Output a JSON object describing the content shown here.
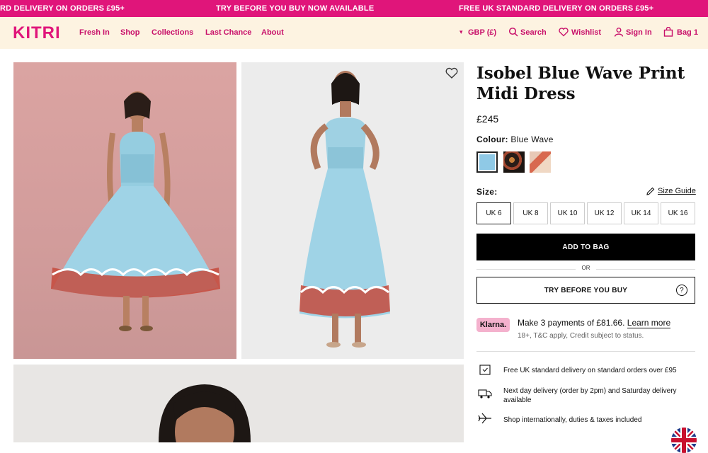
{
  "promo": {
    "left": "RD DELIVERY ON ORDERS £95+",
    "center": "TRY BEFORE YOU BUY NOW AVAILABLE",
    "right": "FREE UK STANDARD DELIVERY ON ORDERS £95+"
  },
  "nav": {
    "logo": "KITRI",
    "links": [
      "Fresh In",
      "Shop",
      "Collections",
      "Last Chance",
      "About"
    ],
    "currency": "GBP (£)",
    "search": "Search",
    "wishlist": "Wishlist",
    "signin": "Sign In",
    "bag": "Bag 1"
  },
  "product": {
    "title": "Isobel Blue Wave Print Midi Dress",
    "price": "£245",
    "colour_label": "Colour:",
    "colour_value": "Blue Wave",
    "size_label": "Size:",
    "size_guide": "Size Guide",
    "sizes": [
      "UK 6",
      "UK 8",
      "UK 10",
      "UK 12",
      "UK 14",
      "UK 16"
    ],
    "selected_size": "UK 6",
    "add_to_bag": "ADD TO BAG",
    "or": "OR",
    "try_before": "TRY BEFORE YOU BUY",
    "try_help": "?"
  },
  "klarna": {
    "logo": "Klarna.",
    "text": "Make 3 payments of £81.66.",
    "link": "Learn more",
    "sub": "18+, T&C apply, Credit subject to status."
  },
  "info": [
    "Free UK standard delivery on standard orders over £95",
    "Next day delivery (order by 2pm) and Saturday delivery available",
    "Shop internationally, duties & taxes included"
  ],
  "colors": {
    "brand_pink": "#e0157a",
    "nav_bg": "#fdf3e1",
    "swatch_blue": "#8fc9e6"
  }
}
